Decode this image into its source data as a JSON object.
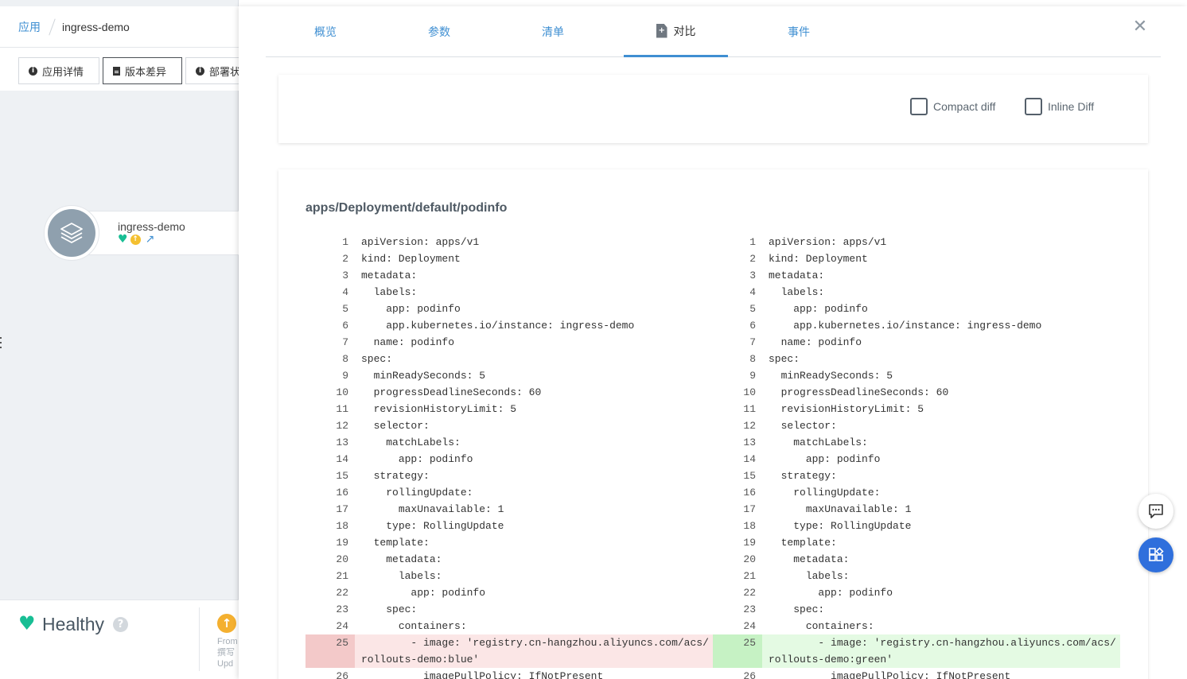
{
  "left": {
    "breadcrumb": {
      "app_label": "应用",
      "app_name": "ingress-demo"
    },
    "toolbar": {
      "details_label": "应用详情",
      "diff_label": "版本差异",
      "deploy_label": "部署状态"
    },
    "node": {
      "name": "ingress-demo"
    },
    "status": {
      "health_label": "Healthy",
      "sync_lines": [
        "From",
        "撰写",
        "Upd"
      ]
    }
  },
  "panel": {
    "tabs": [
      {
        "label": "概览"
      },
      {
        "label": "参数"
      },
      {
        "label": "清单"
      },
      {
        "label": "对比",
        "active": true
      },
      {
        "label": "事件"
      }
    ],
    "options": {
      "compact_diff_label": "Compact diff",
      "inline_diff_label": "Inline Diff",
      "compact_checked": false,
      "inline_checked": false
    },
    "diff": {
      "title": "apps/Deployment/default/podinfo",
      "rows": [
        {
          "ln": "1",
          "left": "apiVersion: apps/v1",
          "right": "apiVersion: apps/v1"
        },
        {
          "ln": "2",
          "left": "kind: Deployment",
          "right": "kind: Deployment"
        },
        {
          "ln": "3",
          "left": "metadata:",
          "right": "metadata:"
        },
        {
          "ln": "4",
          "left": "  labels:",
          "right": "  labels:"
        },
        {
          "ln": "5",
          "left": "    app: podinfo",
          "right": "    app: podinfo"
        },
        {
          "ln": "6",
          "left": "    app.kubernetes.io/instance: ingress-demo",
          "right": "    app.kubernetes.io/instance: ingress-demo"
        },
        {
          "ln": "7",
          "left": "  name: podinfo",
          "right": "  name: podinfo"
        },
        {
          "ln": "8",
          "left": "spec:",
          "right": "spec:"
        },
        {
          "ln": "9",
          "left": "  minReadySeconds: 5",
          "right": "  minReadySeconds: 5"
        },
        {
          "ln": "10",
          "left": "  progressDeadlineSeconds: 60",
          "right": "  progressDeadlineSeconds: 60"
        },
        {
          "ln": "11",
          "left": "  revisionHistoryLimit: 5",
          "right": "  revisionHistoryLimit: 5"
        },
        {
          "ln": "12",
          "left": "  selector:",
          "right": "  selector:"
        },
        {
          "ln": "13",
          "left": "    matchLabels:",
          "right": "    matchLabels:"
        },
        {
          "ln": "14",
          "left": "      app: podinfo",
          "right": "      app: podinfo"
        },
        {
          "ln": "15",
          "left": "  strategy:",
          "right": "  strategy:"
        },
        {
          "ln": "16",
          "left": "    rollingUpdate:",
          "right": "    rollingUpdate:"
        },
        {
          "ln": "17",
          "left": "      maxUnavailable: 1",
          "right": "      maxUnavailable: 1"
        },
        {
          "ln": "18",
          "left": "    type: RollingUpdate",
          "right": "    type: RollingUpdate"
        },
        {
          "ln": "19",
          "left": "  template:",
          "right": "  template:"
        },
        {
          "ln": "20",
          "left": "    metadata:",
          "right": "    metadata:"
        },
        {
          "ln": "21",
          "left": "      labels:",
          "right": "      labels:"
        },
        {
          "ln": "22",
          "left": "        app: podinfo",
          "right": "        app: podinfo"
        },
        {
          "ln": "23",
          "left": "    spec:",
          "right": "    spec:"
        },
        {
          "ln": "24",
          "left": "      containers:",
          "right": "      containers:"
        },
        {
          "ln": "25",
          "left": "        - image: 'registry.cn-hangzhou.aliyuncs.com/acs/rollouts-demo:blue'",
          "right": "        - image: 'registry.cn-hangzhou.aliyuncs.com/acs/rollouts-demo:green'",
          "changed": true
        },
        {
          "ln": "26",
          "left": "          imagePullPolicy: IfNotPresent",
          "right": "          imagePullPolicy: IfNotPresent"
        }
      ]
    }
  },
  "colors": {
    "accent": "#3f8fd2",
    "healthy": "#18be94",
    "deleted_bg": "#fbe6e6",
    "added_bg": "#e4fae3",
    "fab": "#2f6fdc"
  }
}
